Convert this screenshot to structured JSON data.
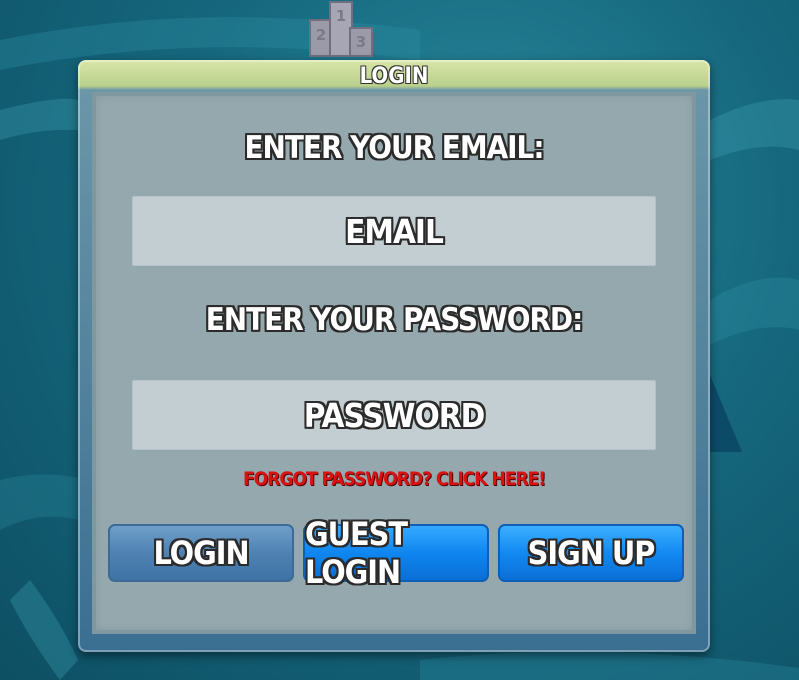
{
  "panel": {
    "title": "LOGIN",
    "email_label": "ENTER YOUR EMAIL:",
    "email_placeholder": "EMAIL",
    "password_label": "ENTER YOUR PASSWORD:",
    "password_placeholder": "PASSWORD",
    "forgot_link": "FORGOT PASSWORD? CLICK HERE!"
  },
  "buttons": {
    "login": "LOGIN",
    "guest_login": "GUEST LOGIN",
    "sign_up": "SIGN UP"
  },
  "podium": {
    "icon": "podium-icon",
    "places": [
      "2",
      "1",
      "3"
    ]
  },
  "colors": {
    "forgot_link": "#d91212",
    "guest_button": "#0f86f0",
    "login_button": "#4f82b3",
    "background": "#16687e"
  }
}
